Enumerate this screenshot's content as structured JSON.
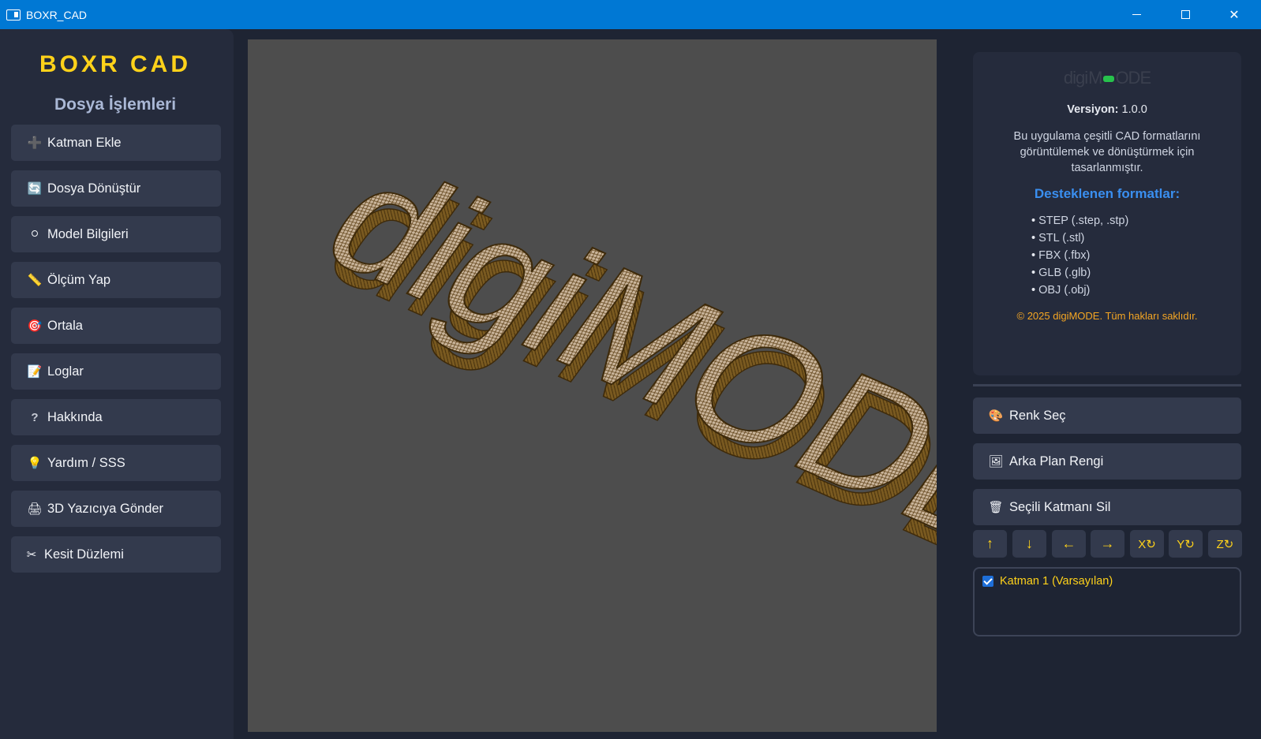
{
  "window": {
    "title": "BOXR_CAD",
    "min_symbol": "",
    "close_symbol": "✕"
  },
  "sidebar": {
    "brand": "BOXR CAD",
    "section_title": "Dosya İşlemleri",
    "items": [
      {
        "icon": "plus-icon",
        "glyph": "➕",
        "label": "Katman Ekle"
      },
      {
        "icon": "convert-icon",
        "glyph": "🔄",
        "label": "Dosya Dönüştür"
      },
      {
        "icon": "info-icon",
        "glyph": "⭘",
        "label": "Model Bilgileri"
      },
      {
        "icon": "ruler-icon",
        "glyph": "📏",
        "label": "Ölçüm Yap"
      },
      {
        "icon": "target-icon",
        "glyph": "🎯",
        "label": "Ortala"
      },
      {
        "icon": "log-icon",
        "glyph": "📝",
        "label": "Loglar"
      },
      {
        "icon": "question-icon",
        "glyph": "?",
        "label": "Hakkında"
      },
      {
        "icon": "lightbulb-icon",
        "glyph": "💡",
        "label": "Yardım / SSS"
      },
      {
        "icon": "printer-icon",
        "glyph": "🖨",
        "label": "3D Yazıcıya Gönder"
      },
      {
        "icon": "scissors-icon",
        "glyph": "✂",
        "label": "Kesit Düzlemi"
      }
    ]
  },
  "viewport": {
    "model_text": "digiMODE",
    "background": "#4d4d4d"
  },
  "info": {
    "logo_left": "digi",
    "logo_right": "ODE",
    "version_label": "Versiyon:",
    "version_value": "1.0.0",
    "description": "Bu uygulama çeşitli CAD formatlarını görüntülemek ve dönüştürmek için tasarlanmıştır.",
    "formats_title": "Desteklenen formatlar:",
    "formats": [
      "STEP (.step, .stp)",
      "STL (.stl)",
      "FBX (.fbx)",
      "GLB (.glb)",
      "OBJ (.obj)"
    ],
    "copyright": "© 2025 digiMODE. Tüm hakları saklıdır."
  },
  "actions": [
    {
      "icon": "palette-icon",
      "glyph": "🎨",
      "label": "Renk Seç"
    },
    {
      "icon": "picture-icon",
      "glyph": "🖼",
      "label": "Arka Plan Rengi"
    },
    {
      "icon": "trash-icon",
      "glyph": "🗑",
      "label": "Seçili Katmanı Sil"
    }
  ],
  "controls": [
    {
      "name": "move-up-button",
      "label": "↑"
    },
    {
      "name": "move-down-button",
      "label": "↓"
    },
    {
      "name": "move-left-button",
      "label": "←"
    },
    {
      "name": "move-right-button",
      "label": "→"
    },
    {
      "name": "rotate-x-button",
      "label": "X↻"
    },
    {
      "name": "rotate-y-button",
      "label": "Y↻"
    },
    {
      "name": "rotate-z-button",
      "label": "Z↻"
    }
  ],
  "layers": [
    {
      "label": "Katman 1 (Varsayılan)",
      "checked": true
    }
  ],
  "colors": {
    "accent_yellow": "#ffd21a",
    "accent_blue": "#3a8ff0",
    "accent_orange": "#f5a623",
    "titlebar": "#0078d4",
    "model_fill": "#c9b49a",
    "model_wire": "#5a3d12"
  }
}
